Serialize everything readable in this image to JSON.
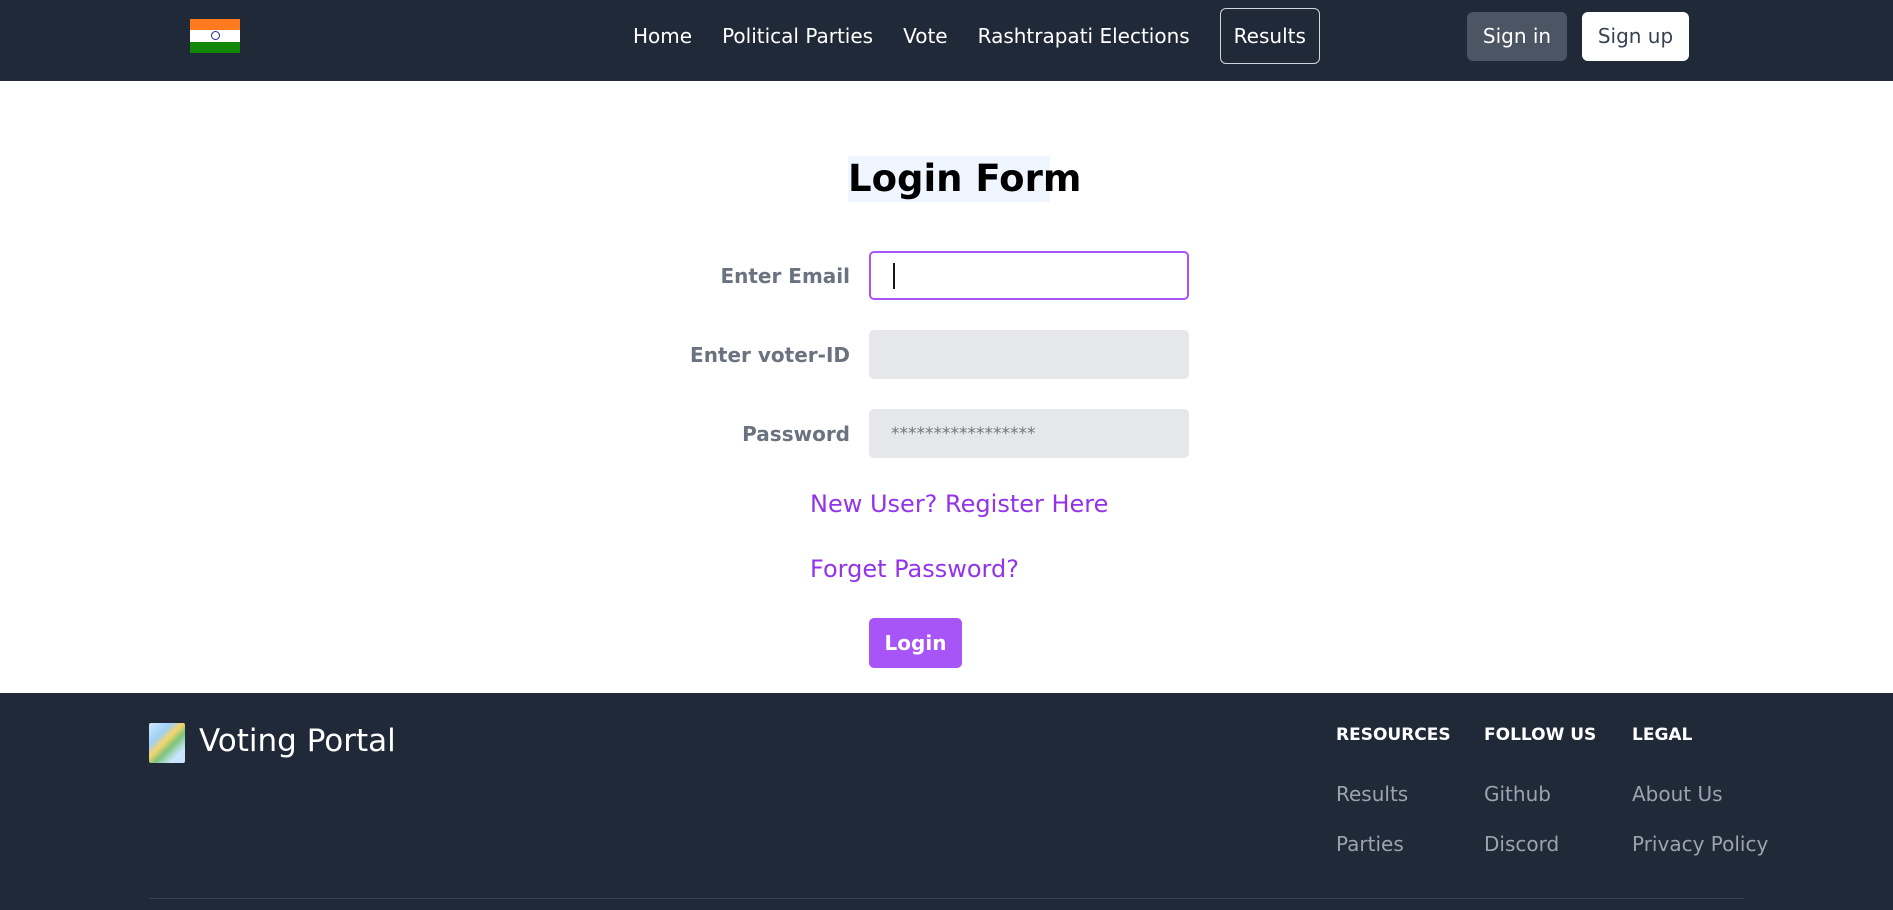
{
  "navbar": {
    "links": [
      "Home",
      "Political Parties",
      "Vote",
      "Rashtrapati Elections",
      "Results"
    ],
    "sign_in": "Sign in",
    "sign_up": "Sign up"
  },
  "form": {
    "title": "Login Form",
    "email_label": "Enter Email",
    "email_value": "",
    "voter_id_label": "Enter voter-ID",
    "voter_id_value": "",
    "password_label": "Password",
    "password_placeholder": "*****************",
    "register_link": "New User? Register Here",
    "forget_link": "Forget Password?",
    "login_button": "Login"
  },
  "footer": {
    "brand": "Voting Portal",
    "columns": [
      {
        "heading": "RESOURCES",
        "links": [
          "Results",
          "Parties"
        ]
      },
      {
        "heading": "FOLLOW US",
        "links": [
          "Github",
          "Discord"
        ]
      },
      {
        "heading": "LEGAL",
        "links": [
          "About Us",
          "Privacy Policy"
        ]
      }
    ]
  },
  "colors": {
    "nav_bg": "#1f2937",
    "accent": "#a855f7",
    "link": "#9333ea"
  }
}
